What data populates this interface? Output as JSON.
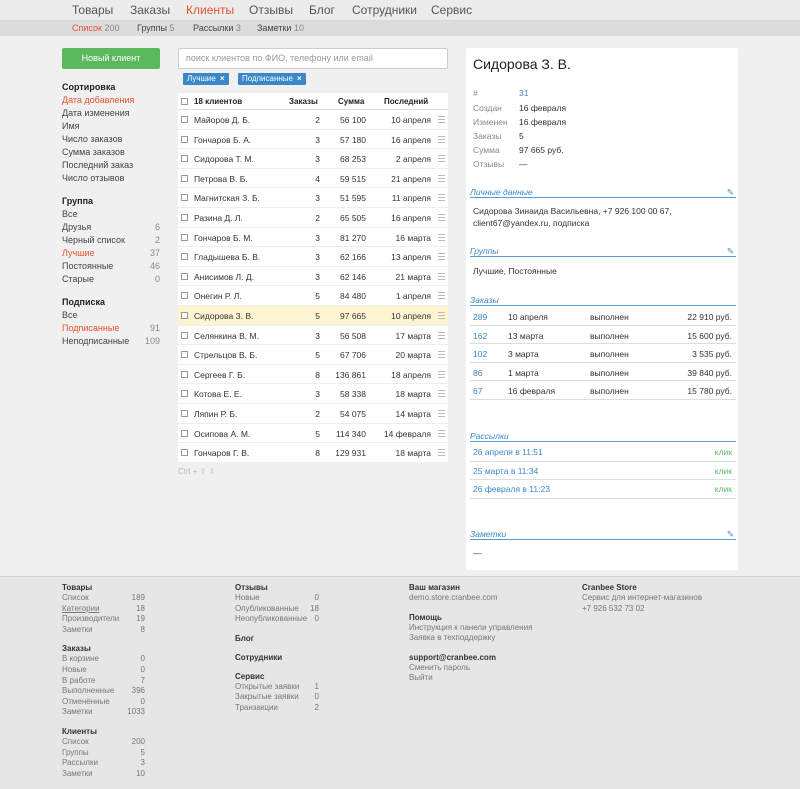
{
  "nav": {
    "items": [
      "Товары",
      "Заказы",
      "Клиенты",
      "Отзывы",
      "Блог",
      "Сотрудники",
      "Сервис"
    ],
    "active": "Клиенты",
    "sub": [
      {
        "label": "Список",
        "count": "200"
      },
      {
        "label": "Группы",
        "count": "5"
      },
      {
        "label": "Рассылки",
        "count": "3"
      },
      {
        "label": "Заметки",
        "count": "10"
      }
    ]
  },
  "new_client": "Новый клиент",
  "sort": {
    "title": "Сортировка",
    "options": [
      "Дата добавления",
      "Дата изменения",
      "Имя",
      "Число заказов",
      "Сумма заказов",
      "Последний заказ",
      "Число отзывов"
    ]
  },
  "group": {
    "title": "Группа",
    "options": [
      {
        "label": "Все",
        "count": ""
      },
      {
        "label": "Друзья",
        "count": "6"
      },
      {
        "label": "Черный список",
        "count": "2"
      },
      {
        "label": "Лучшие",
        "count": "37"
      },
      {
        "label": "Постоянные",
        "count": "46"
      },
      {
        "label": "Старые",
        "count": "0"
      }
    ]
  },
  "subscription": {
    "title": "Подписка",
    "options": [
      {
        "label": "Все",
        "count": ""
      },
      {
        "label": "Подписанные",
        "count": "91"
      },
      {
        "label": "Неподписанные",
        "count": "109"
      }
    ]
  },
  "search": {
    "placeholder": "поиск клиентов по ФИО, телефону или email"
  },
  "tags": [
    "Лучшие",
    "Подписанные"
  ],
  "table": {
    "headers": {
      "name": "18 клиентов",
      "orders": "Заказы",
      "sum": "Сумма",
      "last": "Последний"
    },
    "rows": [
      {
        "name": "Майоров Д. Б.",
        "orders": "2",
        "sum": "56 100",
        "last": "10 апреля"
      },
      {
        "name": "Гончаров Б. А.",
        "orders": "3",
        "sum": "57 180",
        "last": "16 апреля"
      },
      {
        "name": "Сидорова Т. М.",
        "orders": "3",
        "sum": "68 253",
        "last": "2 апреля"
      },
      {
        "name": "Петрова В. Б.",
        "orders": "4",
        "sum": "59 515",
        "last": "21 апреля"
      },
      {
        "name": "Магнитская З. Б.",
        "orders": "3",
        "sum": "51 595",
        "last": "11 апреля"
      },
      {
        "name": "Разина Д. Л.",
        "orders": "2",
        "sum": "65 505",
        "last": "16 апреля"
      },
      {
        "name": "Гончаров Б. М.",
        "orders": "3",
        "sum": "81 270",
        "last": "16 марта"
      },
      {
        "name": "Гладышева Б. В.",
        "orders": "3",
        "sum": "62 166",
        "last": "13 апреля"
      },
      {
        "name": "Анисимов Л. Д.",
        "orders": "3",
        "sum": "62 146",
        "last": "21 марта"
      },
      {
        "name": "Онегин Р. Л.",
        "orders": "5",
        "sum": "84 480",
        "last": "1 апреля"
      },
      {
        "name": "Сидорова З. В.",
        "orders": "5",
        "sum": "97 665",
        "last": "10 апреля",
        "selected": true
      },
      {
        "name": "Селянкина В. М.",
        "orders": "3",
        "sum": "56 508",
        "last": "17 марта"
      },
      {
        "name": "Стрельцов В. Б.",
        "orders": "5",
        "sum": "67 706",
        "last": "20 марта"
      },
      {
        "name": "Сергеев Г. Б.",
        "orders": "8",
        "sum": "136 861",
        "last": "18 апреля"
      },
      {
        "name": "Котова Е. Е.",
        "orders": "3",
        "sum": "58 338",
        "last": "18 марта"
      },
      {
        "name": "Ляпин Р. Б.",
        "orders": "2",
        "sum": "54 075",
        "last": "14 марта"
      },
      {
        "name": "Осипова А. М.",
        "orders": "5",
        "sum": "114 340",
        "last": "14 февраля"
      },
      {
        "name": "Гончаров Г. В.",
        "orders": "8",
        "sum": "129 931",
        "last": "18 марта"
      }
    ]
  },
  "hint": "Ctrl + ⇧ ⇩",
  "client": {
    "name": "Сидорова З. В.",
    "meta": [
      {
        "label": "#",
        "value": "31"
      },
      {
        "label": "Создан",
        "value": "16 февраля"
      },
      {
        "label": "Изменен",
        "value": "16 февраля"
      },
      {
        "label": "Заказы",
        "value": "5"
      },
      {
        "label": "Сумма",
        "value": "97 665 руб."
      },
      {
        "label": "Отзывы",
        "value": "—"
      }
    ],
    "personal": {
      "title": "Личные данные",
      "line1": "Сидорова Зинаида Васильевна, +7 926 100 00 67,",
      "line2": "client67@yandex.ru, подписка"
    },
    "groups": {
      "title": "Группы",
      "value": "Лучшие, Постоянные"
    },
    "orders": {
      "title": "Заказы",
      "rows": [
        {
          "id": "289",
          "date": "10 апреля",
          "status": "выполнен",
          "sum": "22 910 руб."
        },
        {
          "id": "162",
          "date": "13 марта",
          "status": "выполнен",
          "sum": "15 600 руб."
        },
        {
          "id": "102",
          "date": "3 марта",
          "status": "выполнен",
          "sum": "3 535 руб."
        },
        {
          "id": "86",
          "date": "1 марта",
          "status": "выполнен",
          "sum": "39 840 руб."
        },
        {
          "id": "67",
          "date": "16 февраля",
          "status": "выполнен",
          "sum": "15 780 руб."
        }
      ]
    },
    "mailings": {
      "title": "Рассылки",
      "rows": [
        {
          "date": "26 апреля в 11:51",
          "action": "клик"
        },
        {
          "date": "25 марта в 11:34",
          "action": "клик"
        },
        {
          "date": "26 февраля в 11:23",
          "action": "клик"
        }
      ]
    },
    "notes": {
      "title": "Заметки",
      "value": "—"
    }
  },
  "footer": {
    "col1": [
      {
        "title": "Товары",
        "items": [
          {
            "l": "Список",
            "n": "189"
          },
          {
            "l": "Категории",
            "n": "18",
            "u": true
          },
          {
            "l": "Производители",
            "n": "19"
          },
          {
            "l": "Заметки",
            "n": "8"
          }
        ]
      },
      {
        "title": "Заказы",
        "items": [
          {
            "l": "В корзине",
            "n": "0"
          },
          {
            "l": "Новые",
            "n": "0"
          },
          {
            "l": "В работе",
            "n": "7"
          },
          {
            "l": "Выполненные",
            "n": "396"
          },
          {
            "l": "Отменённые",
            "n": "0"
          },
          {
            "l": "Заметки",
            "n": "1033"
          }
        ]
      },
      {
        "title": "Клиенты",
        "items": [
          {
            "l": "Список",
            "n": "200"
          },
          {
            "l": "Группы",
            "n": "5"
          },
          {
            "l": "Рассылки",
            "n": "3"
          },
          {
            "l": "Заметки",
            "n": "10"
          }
        ]
      }
    ],
    "col2": [
      {
        "title": "Отзывы",
        "items": [
          {
            "l": "Новые",
            "n": "0"
          },
          {
            "l": "Опубликованные",
            "n": "18"
          },
          {
            "l": "Неопубликованные",
            "n": "0"
          }
        ]
      },
      {
        "title": "Блог",
        "items": []
      },
      {
        "title": "Сотрудники",
        "items": []
      },
      {
        "title": "Сервис",
        "items": [
          {
            "l": "Открытые заявки",
            "n": "1"
          },
          {
            "l": "Закрытые заявки",
            "n": "0"
          },
          {
            "l": "Транзакции",
            "n": "2"
          }
        ]
      }
    ],
    "col3": [
      {
        "title": "Ваш магазин",
        "items": [
          {
            "l": "demo.store.cranbee.com",
            "n": ""
          }
        ]
      },
      {
        "title": "Помощь",
        "items": [
          {
            "l": "Инструкция к панели управления",
            "n": ""
          },
          {
            "l": "Заявка в техподдержку",
            "n": ""
          }
        ]
      },
      {
        "title": "support@cranbee.com",
        "items": [
          {
            "l": "Сменить пароль",
            "n": ""
          },
          {
            "l": "Выйти",
            "n": ""
          }
        ]
      }
    ],
    "col4": [
      {
        "title": "Cranbee Store",
        "items": [
          {
            "l": "Сервис для интернет-магазинов",
            "n": ""
          },
          {
            "l": "+7 926 532 73 02",
            "n": ""
          }
        ]
      }
    ]
  }
}
